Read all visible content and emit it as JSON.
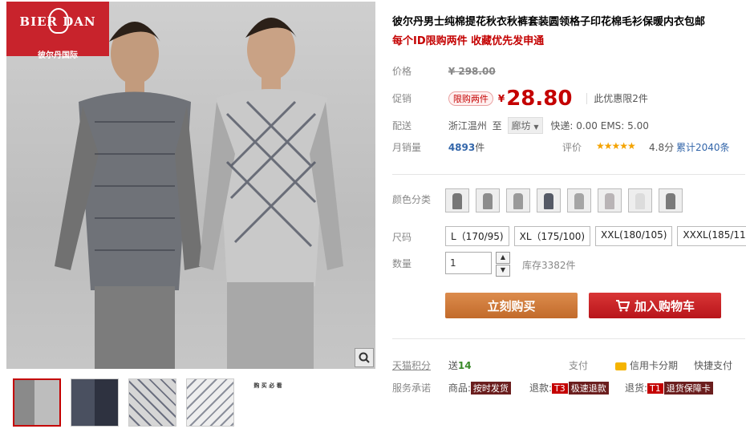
{
  "brand": {
    "logo_text": "BIER DAN",
    "logo_sub": "gentleman",
    "company": "彼尔丹国际"
  },
  "product": {
    "title": "彼尔丹男士纯棉提花秋衣秋裤套装圆领格子印花棉毛衫保暖内衣包邮",
    "subtitle": "每个ID限购两件 收藏优先发申通"
  },
  "price": {
    "label": "价格",
    "original": "¥ 298.00"
  },
  "promo": {
    "label": "促销",
    "tag": "限购两件",
    "currency": "¥",
    "value": "28.80",
    "note": "此优惠限2件"
  },
  "shipping": {
    "label": "配送",
    "origin": "浙江温州",
    "to": "至",
    "destination": "廊坊",
    "fee": "快递: 0.00 EMS: 5.00"
  },
  "sales": {
    "label": "月销量",
    "count": "4893",
    "unit": "件",
    "rating_label": "评价",
    "stars": "★★★★★",
    "score": "4.8分",
    "reviews": "累计2040条"
  },
  "colors": {
    "label": "颜色分类",
    "swatches": [
      "#777777",
      "#8d8d8d",
      "#9a9a9a",
      "#555a66",
      "#a5a5a5",
      "#b9b4b6",
      "#dcdcdc",
      "#7a7a7a"
    ]
  },
  "sizes": {
    "label": "尺码",
    "options": [
      "L（170/95)",
      "XL（175/100)",
      "XXL(180/105)",
      "XXXL(185/110)"
    ]
  },
  "quantity": {
    "label": "数量",
    "value": "1",
    "stock": "库存3382件"
  },
  "actions": {
    "buy": "立刻购买",
    "cart": "加入购物车"
  },
  "points": {
    "label": "天猫积分",
    "text_prefix": "送",
    "value": "14",
    "pay_label": "支付",
    "credit": "信用卡分期",
    "quick": "快捷支付"
  },
  "service": {
    "label": "服务承诺",
    "goods_label": "商品:",
    "goods_tag": "按时发货",
    "refund_label": "退款:",
    "refund_code": "T3",
    "refund_tag": "极速退款",
    "return_label": "退货:",
    "return_code": "T1",
    "return_tag": "退货保障卡"
  },
  "thumbnails": {
    "info_title": "购 买 必 看"
  }
}
